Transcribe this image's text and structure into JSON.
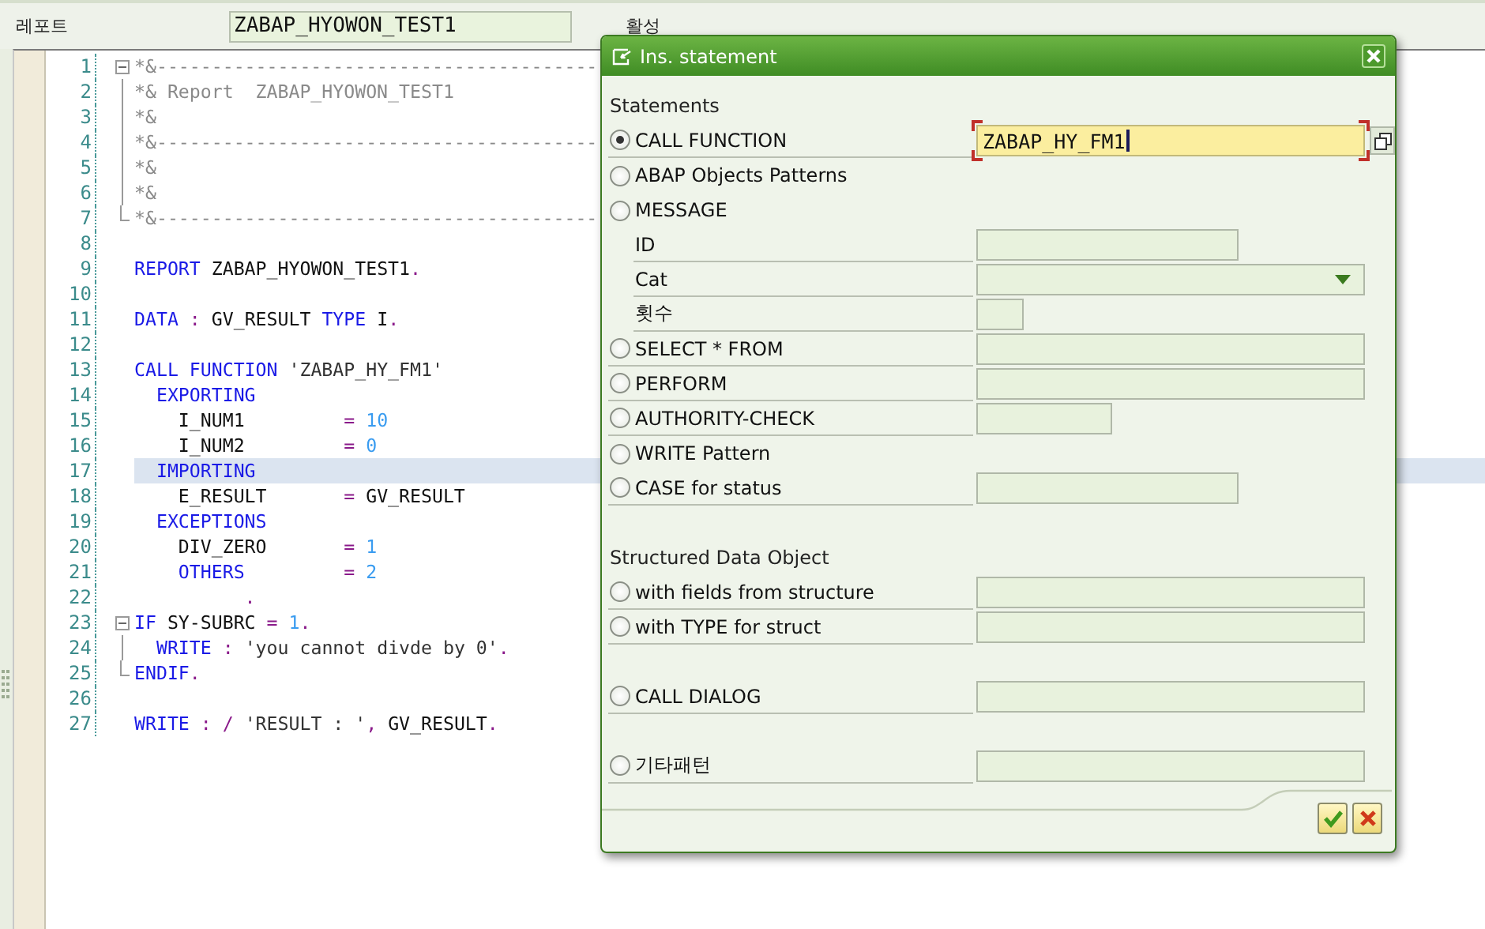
{
  "header": {
    "label": "레포트",
    "program": "ZABAP_HYOWON_TEST1",
    "status": "활성"
  },
  "editor": {
    "lines": [
      {
        "number": "1",
        "current": false,
        "tokens": [
          {
            "kind": "comment",
            "text": "*&----------------------------------------"
          }
        ],
        "children": [
          {
            "number": "2",
            "current": false,
            "tokens": [
              {
                "kind": "comment",
                "text": "*& Report  ZABAP_HYOWON_TEST1"
              }
            ]
          },
          {
            "number": "3",
            "current": false,
            "tokens": [
              {
                "kind": "comment",
                "text": "*&"
              }
            ]
          },
          {
            "number": "4",
            "current": false,
            "tokens": [
              {
                "kind": "comment",
                "text": "*&----------------------------------------"
              }
            ]
          },
          {
            "number": "5",
            "current": false,
            "tokens": [
              {
                "kind": "comment",
                "text": "*&"
              }
            ]
          },
          {
            "number": "6",
            "current": false,
            "tokens": [
              {
                "kind": "comment",
                "text": "*&"
              }
            ]
          },
          {
            "number": "7",
            "current": false,
            "tokens": [
              {
                "kind": "comment",
                "text": "*&----------------------------------------"
              }
            ]
          }
        ]
      },
      {
        "number": "8",
        "current": false
      },
      {
        "number": "9",
        "current": false,
        "tokens": [
          {
            "kind": "keyword",
            "text": "REPORT"
          },
          {
            "kind": "plain",
            "text": " ZABAP_HYOWON_TEST1"
          },
          {
            "kind": "operator",
            "text": "."
          }
        ]
      },
      {
        "number": "10",
        "current": false
      },
      {
        "number": "11",
        "current": false,
        "tokens": [
          {
            "kind": "keyword",
            "text": "DATA"
          },
          {
            "kind": "operator",
            "text": " : "
          },
          {
            "kind": "plain",
            "text": "GV_RESULT "
          },
          {
            "kind": "keyword",
            "text": "TYPE"
          },
          {
            "kind": "plain",
            "text": " I"
          },
          {
            "kind": "operator",
            "text": "."
          }
        ]
      },
      {
        "number": "12",
        "current": false
      },
      {
        "number": "13",
        "current": false,
        "tokens": [
          {
            "kind": "keyword",
            "text": "CALL FUNCTION"
          },
          {
            "kind": "string",
            "text": " 'ZABAP_HY_FM1'"
          }
        ]
      },
      {
        "number": "14",
        "current": false,
        "tokens": [
          {
            "kind": "keyword",
            "text": "  EXPORTING"
          }
        ]
      },
      {
        "number": "15",
        "current": false,
        "tokens": [
          {
            "kind": "plain",
            "text": "    I_NUM1         "
          },
          {
            "kind": "operator",
            "text": "= "
          },
          {
            "kind": "number",
            "text": "10"
          }
        ]
      },
      {
        "number": "16",
        "current": false,
        "tokens": [
          {
            "kind": "plain",
            "text": "    I_NUM2         "
          },
          {
            "kind": "operator",
            "text": "= "
          },
          {
            "kind": "number",
            "text": "0"
          }
        ]
      },
      {
        "number": "17",
        "current": true,
        "tokens": [
          {
            "kind": "keyword",
            "text": "  IMPORTING"
          }
        ]
      },
      {
        "number": "18",
        "current": false,
        "tokens": [
          {
            "kind": "plain",
            "text": "    E_RESULT       "
          },
          {
            "kind": "operator",
            "text": "= "
          },
          {
            "kind": "plain",
            "text": "GV_RESULT"
          }
        ]
      },
      {
        "number": "19",
        "current": false,
        "tokens": [
          {
            "kind": "keyword",
            "text": "  EXCEPTIONS"
          }
        ]
      },
      {
        "number": "20",
        "current": false,
        "tokens": [
          {
            "kind": "plain",
            "text": "    DIV_ZERO       "
          },
          {
            "kind": "operator",
            "text": "= "
          },
          {
            "kind": "number",
            "text": "1"
          }
        ]
      },
      {
        "number": "21",
        "current": false,
        "tokens": [
          {
            "kind": "keyword",
            "text": "    OTHERS"
          },
          {
            "kind": "operator",
            "text": "         = "
          },
          {
            "kind": "number",
            "text": "2"
          }
        ]
      },
      {
        "number": "22",
        "current": false,
        "tokens": [
          {
            "kind": "operator",
            "text": "          ."
          }
        ]
      },
      {
        "number": "23",
        "current": false,
        "tokens": [
          {
            "kind": "keyword",
            "text": "IF"
          },
          {
            "kind": "plain",
            "text": " SY-SUBRC "
          },
          {
            "kind": "operator",
            "text": "= "
          },
          {
            "kind": "number",
            "text": "1"
          },
          {
            "kind": "operator",
            "text": "."
          }
        ],
        "children": [
          {
            "number": "24",
            "current": false,
            "tokens": [
              {
                "kind": "keyword",
                "text": "  WRITE"
              },
              {
                "kind": "operator",
                "text": " : "
              },
              {
                "kind": "string",
                "text": "'you cannot divde by 0'"
              },
              {
                "kind": "operator",
                "text": "."
              }
            ]
          },
          {
            "number": "25",
            "current": false,
            "tokens": [
              {
                "kind": "keyword",
                "text": "ENDIF"
              },
              {
                "kind": "operator",
                "text": "."
              }
            ]
          }
        ]
      },
      {
        "number": "26",
        "current": false
      },
      {
        "number": "27",
        "current": false,
        "tokens": [
          {
            "kind": "keyword",
            "text": "WRITE"
          },
          {
            "kind": "operator",
            "text": " : / "
          },
          {
            "kind": "string",
            "text": "'RESULT : '"
          },
          {
            "kind": "operator",
            "text": ", "
          },
          {
            "kind": "plain",
            "text": "GV_RESULT"
          },
          {
            "kind": "operator",
            "text": "."
          }
        ]
      }
    ]
  },
  "dialog": {
    "title": "Ins. statement",
    "groups": [
      [
        {
          "kind": "heading",
          "label": "Statements"
        },
        {
          "kind": "radio",
          "label": "CALL FUNCTION",
          "selected": true,
          "field": {
            "kind": "search",
            "value": "ZABAP_HY_FM1",
            "focused": true
          }
        },
        {
          "kind": "radio",
          "label": "ABAP Objects Patterns",
          "selected": false
        },
        {
          "kind": "radio",
          "label": "MESSAGE",
          "selected": false
        },
        {
          "kind": "label",
          "label": "ID",
          "field": {
            "kind": "medium"
          }
        },
        {
          "kind": "label",
          "label": "Cat",
          "field": {
            "kind": "dropdown"
          }
        },
        {
          "kind": "label",
          "label": "횟수",
          "field": {
            "kind": "tiny"
          }
        },
        {
          "kind": "radio",
          "label": "SELECT * FROM",
          "selected": false,
          "field": {
            "kind": "long"
          }
        },
        {
          "kind": "radio",
          "label": "PERFORM",
          "selected": false,
          "field": {
            "kind": "long"
          }
        },
        {
          "kind": "radio",
          "label": "AUTHORITY-CHECK",
          "selected": false,
          "field": {
            "kind": "short"
          }
        },
        {
          "kind": "radio",
          "label": "WRITE Pattern",
          "selected": false
        },
        {
          "kind": "radio",
          "label": "CASE for status",
          "selected": false,
          "field": {
            "kind": "medium"
          }
        }
      ],
      [
        {
          "kind": "heading",
          "label": "Structured Data Object"
        },
        {
          "kind": "radio",
          "label": "with fields from structure",
          "selected": false,
          "field": {
            "kind": "long"
          }
        },
        {
          "kind": "radio",
          "label": "with TYPE for struct",
          "selected": false,
          "field": {
            "kind": "long"
          }
        }
      ],
      [
        {
          "kind": "radio",
          "label": "CALL DIALOG",
          "selected": false,
          "field": {
            "kind": "long"
          }
        }
      ],
      [
        {
          "kind": "radio",
          "label": "기타패턴",
          "selected": false,
          "field": {
            "kind": "long"
          }
        }
      ]
    ]
  }
}
